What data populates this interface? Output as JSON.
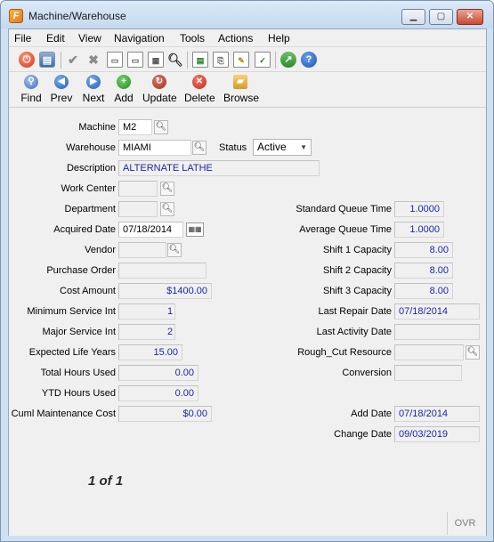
{
  "window": {
    "title": "Machine/Warehouse",
    "app_icon_glyph": "F"
  },
  "menu": [
    "File",
    "Edit",
    "View",
    "Navigation",
    "Tools",
    "Actions",
    "Help"
  ],
  "toolbar_icons": [
    "power-icon",
    "windows-icon",
    "checkmark-icon",
    "cancel-icon",
    "copy-icon",
    "paste-icon",
    "select-all-icon",
    "zoom-icon",
    "report-icon",
    "attach-icon",
    "notes-icon",
    "clipboard-icon",
    "chart-icon",
    "help-icon"
  ],
  "nav": {
    "find": "Find",
    "prev": "Prev",
    "next": "Next",
    "add": "Add",
    "update": "Update",
    "delete": "Delete",
    "browse": "Browse"
  },
  "form": {
    "machine": {
      "label": "Machine",
      "value": "M2"
    },
    "warehouse": {
      "label": "Warehouse",
      "value": "MIAMI"
    },
    "status": {
      "label": "Status",
      "value": "Active"
    },
    "description": {
      "label": "Description",
      "value": "ALTERNATE LATHE"
    },
    "work_center": {
      "label": "Work Center",
      "value": ""
    },
    "department": {
      "label": "Department",
      "value": ""
    },
    "acquired_date": {
      "label": "Acquired Date",
      "value": "07/18/2014"
    },
    "vendor": {
      "label": "Vendor",
      "value": ""
    },
    "purchase_order": {
      "label": "Purchase Order",
      "value": ""
    },
    "cost_amount": {
      "label": "Cost Amount",
      "value": "$1400.00"
    },
    "min_service_int": {
      "label": "Minimum Service Int",
      "value": "1"
    },
    "major_service_int": {
      "label": "Major Service Int",
      "value": "2"
    },
    "expected_life_years": {
      "label": "Expected Life Years",
      "value": "15.00"
    },
    "total_hours_used": {
      "label": "Total Hours Used",
      "value": "0.00"
    },
    "ytd_hours_used": {
      "label": "YTD Hours Used",
      "value": "0.00"
    },
    "cuml_maintenance_cost": {
      "label": "Cuml Maintenance Cost",
      "value": "$0.00"
    },
    "standard_queue_time": {
      "label": "Standard Queue Time",
      "value": "1.0000"
    },
    "average_queue_time": {
      "label": "Average Queue Time",
      "value": "1.0000"
    },
    "shift1_capacity": {
      "label": "Shift 1 Capacity",
      "value": "8.00"
    },
    "shift2_capacity": {
      "label": "Shift 2 Capacity",
      "value": "8.00"
    },
    "shift3_capacity": {
      "label": "Shift 3 Capacity",
      "value": "8.00"
    },
    "last_repair_date": {
      "label": "Last Repair Date",
      "value": "07/18/2014"
    },
    "last_activity_date": {
      "label": "Last Activity Date",
      "value": ""
    },
    "rough_cut_resource": {
      "label": "Rough_Cut Resource",
      "value": ""
    },
    "conversion": {
      "label": "Conversion",
      "value": ""
    },
    "add_date": {
      "label": "Add Date",
      "value": "07/18/2014"
    },
    "change_date": {
      "label": "Change Date",
      "value": "09/03/2019"
    }
  },
  "record_count": "1 of 1",
  "status_bar": {
    "mode": "OVR"
  }
}
